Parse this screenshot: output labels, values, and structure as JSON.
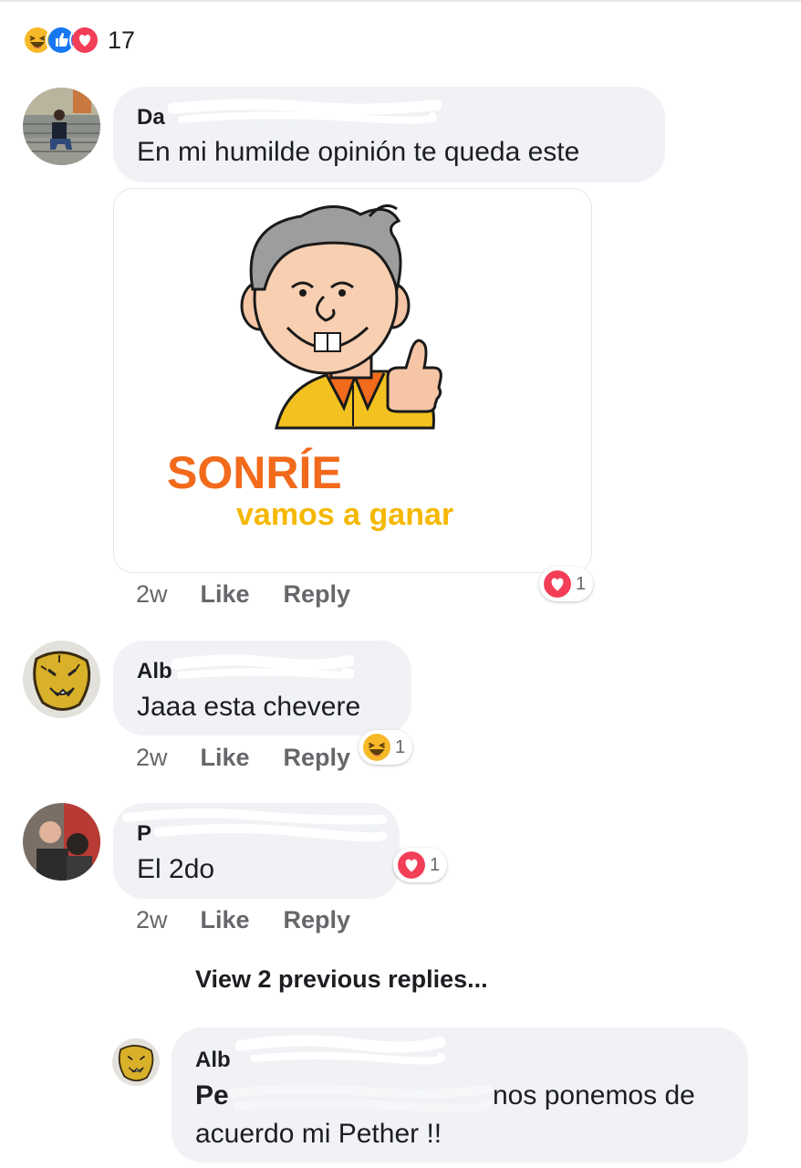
{
  "summary": {
    "count": "17",
    "reactions": [
      "haha",
      "like",
      "love"
    ]
  },
  "sticker": {
    "line1": "SONRÍE",
    "line2": "vamos a ganar"
  },
  "comments": [
    {
      "author": "Da",
      "text": "En mi humilde opinión te queda este",
      "time": "2w",
      "like": "Like",
      "reply": "Reply",
      "reaction": "love",
      "reaction_count": "1"
    },
    {
      "author": "Alb",
      "text": "Jaaa esta chevere",
      "time": "2w",
      "like": "Like",
      "reply": "Reply",
      "reaction": "haha",
      "reaction_count": "1"
    },
    {
      "author": "P",
      "text": "El 2do",
      "time": "2w",
      "like": "Like",
      "reply": "Reply",
      "reaction": "love",
      "reaction_count": "1"
    }
  ],
  "view_previous": "View 2 previous replies...",
  "reply": {
    "author": "Alb",
    "mention": "Pe",
    "text_line1": "nos ponemos de",
    "text_line2": "acuerdo mi Pether !!"
  },
  "colors": {
    "bubble": "#f0f2f5",
    "love": "#f33e58",
    "like": "#1877f2",
    "haha": "#f7b928",
    "meta": "#65676b",
    "sticker_orange": "#f26a1b",
    "sticker_yellow": "#f5b800"
  }
}
